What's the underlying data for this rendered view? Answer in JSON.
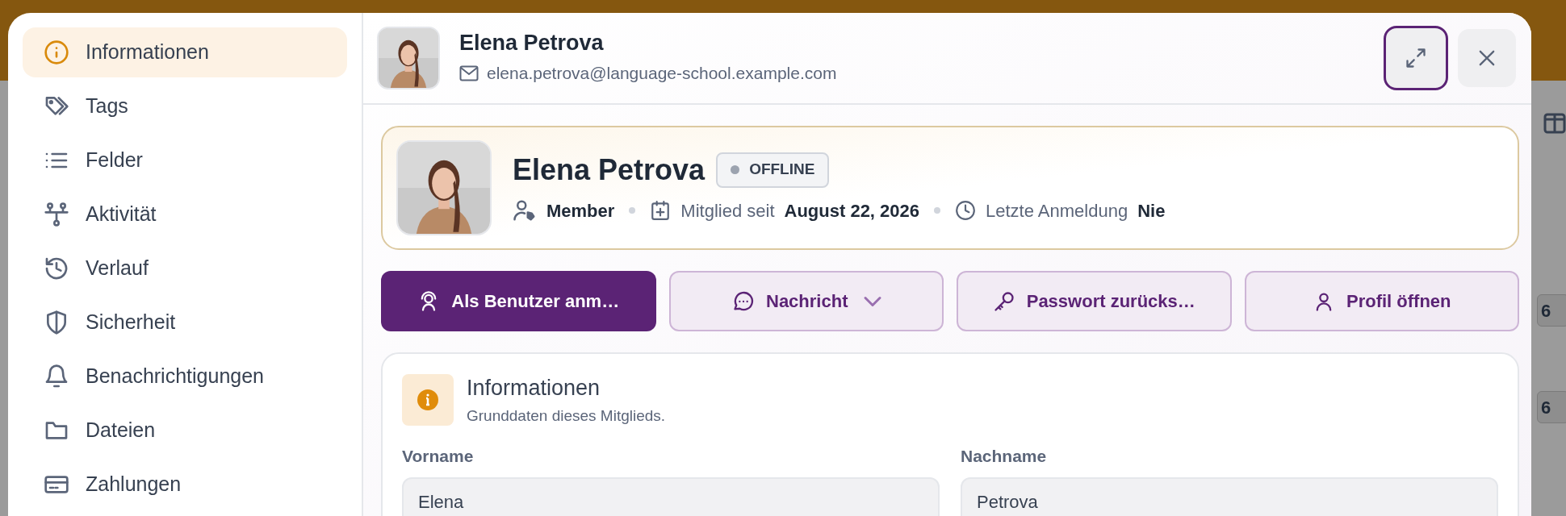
{
  "background": {
    "badges": [
      "6",
      "6"
    ]
  },
  "sidebar": {
    "items": [
      {
        "label": "Informationen",
        "selected": true
      },
      {
        "label": "Tags",
        "selected": false
      },
      {
        "label": "Felder",
        "selected": false
      },
      {
        "label": "Aktivität",
        "selected": false
      },
      {
        "label": "Verlauf",
        "selected": false
      },
      {
        "label": "Sicherheit",
        "selected": false
      },
      {
        "label": "Benachrichtigungen",
        "selected": false
      },
      {
        "label": "Dateien",
        "selected": false
      },
      {
        "label": "Zahlungen",
        "selected": false
      }
    ]
  },
  "header": {
    "name": "Elena Petrova",
    "email": "elena.petrova@language-school.example.com",
    "window_buttons": [
      {
        "kind": "expand",
        "focused": true
      },
      {
        "kind": "close",
        "focused": false
      }
    ]
  },
  "profile": {
    "name": "Elena Petrova",
    "status": "OFFLINE",
    "online": false,
    "role": "Member",
    "member_since_label": "Mitglied seit",
    "member_since": "August 22, 2026",
    "last_login_label": "Letzte Anmeldung",
    "last_login": "Nie"
  },
  "actions": [
    {
      "label": "Als Benutzer anm…",
      "kind": "primary",
      "dropdown": false
    },
    {
      "label": "Nachricht",
      "kind": "secondary",
      "dropdown": true
    },
    {
      "label": "Passwort zurücks…",
      "kind": "secondary",
      "dropdown": false
    },
    {
      "label": "Profil öffnen",
      "kind": "secondary",
      "dropdown": false
    }
  ],
  "section": {
    "title": "Informationen",
    "subtitle": "Grunddaten dieses Mitglieds.",
    "fields": [
      {
        "label": "Vorname",
        "value": "Elena"
      },
      {
        "label": "Nachname",
        "value": "Petrova"
      }
    ]
  }
}
